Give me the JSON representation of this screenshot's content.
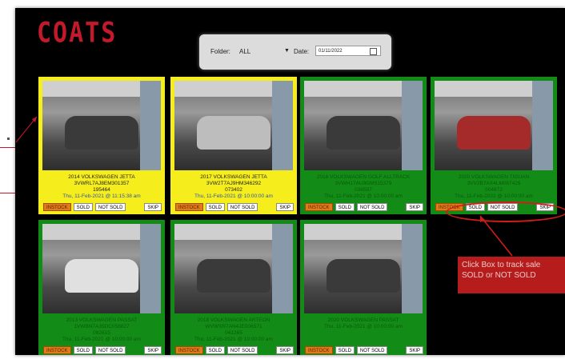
{
  "logo": "COATS",
  "filter": {
    "folder_label": "Folder:",
    "folder_value": "ALL",
    "date_label": "Date:",
    "date_value": "01/11/2022"
  },
  "cards": [
    {
      "color": "yellow",
      "car": "dark",
      "line1": "2014 VOLKSWAGEN JETTA",
      "line2": "3VWRL7AJ8EM301357",
      "line3": "195464",
      "date": "Thu, 11-Feb-2021 @ 11:15:38 am"
    },
    {
      "color": "yellow",
      "car": "silver",
      "line1": "2017 VOLKSWAGEN JETTA",
      "line2": "3VW2T7AJ9HM346292",
      "line3": "073402",
      "date": "Thu, 11-Feb-2021 @ 10:00:00 am"
    },
    {
      "color": "green",
      "car": "dark",
      "line1": "2016 VOLKSWAGEN GOLF ALLTRACK",
      "line2": "3VWH17AU8GM515379",
      "line3": "036597",
      "date": "Thu, 11-Feb-2021 @ 10:00:00 am"
    },
    {
      "color": "green",
      "car": "red",
      "line1": "2020 VOLKSWAGEN TIGUAN",
      "line2": "3VV2B7AX4LM087429",
      "line3": "004872",
      "date": "Thu, 11-Feb-2021 @ 10:00:00 am"
    },
    {
      "color": "green",
      "car": "white",
      "line1": "2013 VOLKSWAGEN PASSAT",
      "line2": "1VWBN7A35DC058827",
      "line3": "082615",
      "date": "Thu, 11-Feb-2021 @ 10:00:00 am"
    },
    {
      "color": "green",
      "car": "dark",
      "line1": "2018 VOLKSWAGEN ARTEON",
      "line2": "WVWSR7AN4JE006571",
      "line3": "041265",
      "date": "Thu, 11-Feb-2021 @ 10:00:00 am"
    },
    {
      "color": "green",
      "car": "dark",
      "line1": "2020 VOLKSWAGEN PASSAT",
      "line2": "",
      "line3": "",
      "date": "Thu, 11-Feb-2021 @ 10:00:00 am"
    }
  ],
  "buttons": {
    "instock": "INSTOCK",
    "sold": "SOLD",
    "notsold": "NOT SOLD",
    "skip": "SKIP"
  },
  "callout": {
    "text": "Click Box to track sale SOLD or NOT SOLD"
  },
  "colors": {
    "yellow": "#f5ee1c",
    "green": "#138c17",
    "accent": "#c2192b",
    "instock": "#e07a1c"
  }
}
